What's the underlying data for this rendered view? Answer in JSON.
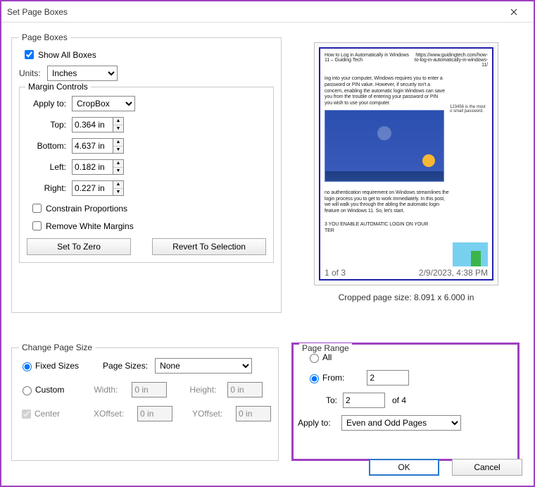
{
  "window": {
    "title": "Set Page Boxes"
  },
  "page_boxes": {
    "legend": "Page Boxes",
    "show_all_label": "Show All Boxes",
    "units_label": "Units:",
    "units_value": "Inches",
    "margin_controls": {
      "legend": "Margin Controls",
      "apply_to_label": "Apply to:",
      "apply_to_value": "CropBox",
      "top_label": "Top:",
      "top_value": "0.364 in",
      "bottom_label": "Bottom:",
      "bottom_value": "4.637 in",
      "left_label": "Left:",
      "left_value": "0.182 in",
      "right_label": "Right:",
      "right_value": "0.227 in",
      "constrain_label": "Constrain Proportions",
      "remove_wm_label": "Remove White Margins",
      "set_zero_label": "Set To Zero",
      "revert_label": "Revert To Selection"
    }
  },
  "preview": {
    "cropped_label": "Cropped page size: 8.091 x 6.000 in",
    "top_left": "How to Log in Automatically in Windows 11 – Guiding Tech",
    "top_right": "https://www.guidingtech.com/how-to-log-in-automatically-in-windows-11/",
    "para1": "ing into your computer, Windows requires you to enter a password or PIN value. However, if security isn't a concern, enabling the automatic login Windows can save you from the trouble of entering your password or PIN you wish to use your computer.",
    "right_note": "123456 is the most o small password.",
    "para2": "no authentication requirement on Windows streamlines the login process you to get to work immediately. In this post, we will walk you through the abling the automatic login feature on Windows 11. So, let's start.",
    "heading": "3 YOU ENABLE AUTOMATIC LOGIN ON YOUR TER",
    "footer_left": "1 of 3",
    "footer_right": "2/9/2023, 4:38 PM"
  },
  "change_size": {
    "legend": "Change Page Size",
    "fixed_label": "Fixed Sizes",
    "page_sizes_label": "Page Sizes:",
    "page_sizes_value": "None",
    "custom_label": "Custom",
    "width_label": "Width:",
    "width_value": "0 in",
    "height_label": "Height:",
    "height_value": "0 in",
    "center_label": "Center",
    "xoffset_label": "XOffset:",
    "xoffset_value": "0 in",
    "yoffset_label": "YOffset:",
    "yoffset_value": "0 in"
  },
  "page_range": {
    "legend": "Page Range",
    "all_label": "All",
    "from_label": "From:",
    "from_value": "2",
    "to_label": "To:",
    "to_value": "2",
    "of_label": "of 4",
    "apply_to_label": "Apply to:",
    "apply_to_value": "Even and Odd Pages"
  },
  "buttons": {
    "ok": "OK",
    "cancel": "Cancel"
  }
}
